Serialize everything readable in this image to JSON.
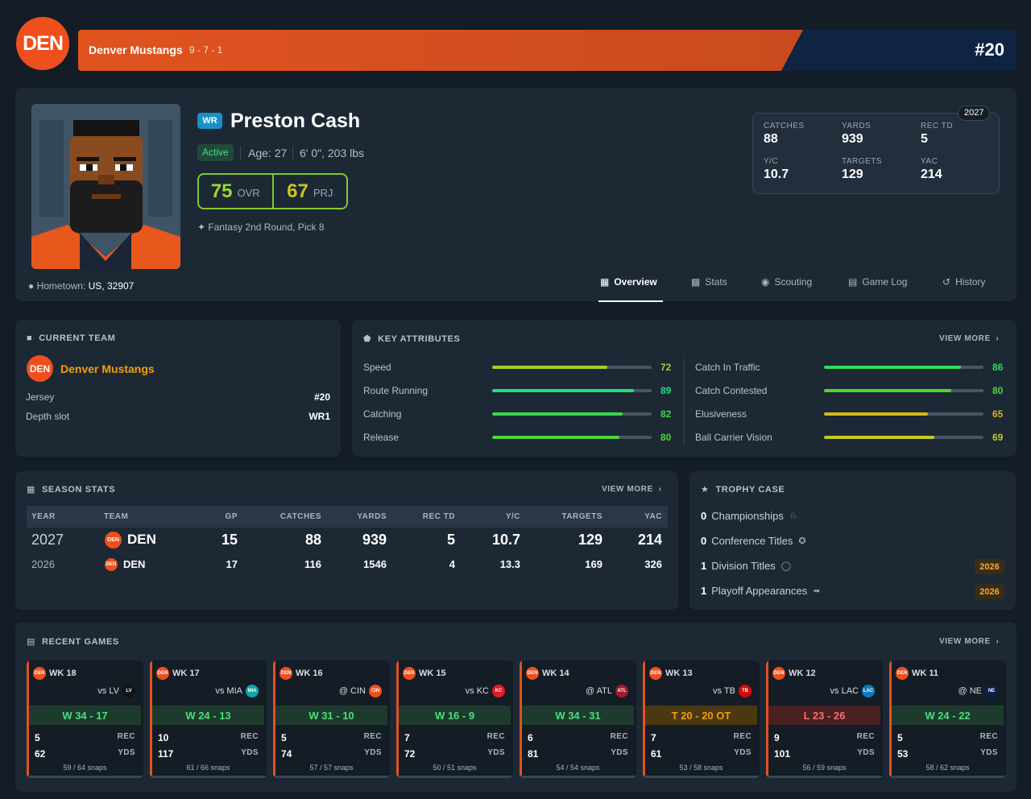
{
  "header": {
    "logo": "DEN",
    "team_name": "Denver Mustangs",
    "record": "9 - 7 - 1",
    "jersey": "#20"
  },
  "player": {
    "position": "WR",
    "name": "Preston Cash",
    "status": "Active",
    "age": "Age: 27",
    "size": "6' 0\", 203 lbs",
    "ovr": "75",
    "ovr_label": "OVR",
    "prj": "67",
    "prj_label": "PRJ",
    "draft": "Fantasy 2nd Round, Pick 8",
    "hometown_label": "Hometown:",
    "hometown": "US, 32907"
  },
  "stat_box": {
    "year": "2027",
    "items": [
      {
        "label": "CATCHES",
        "value": "88"
      },
      {
        "label": "YARDS",
        "value": "939"
      },
      {
        "label": "REC TD",
        "value": "5"
      },
      {
        "label": "Y/C",
        "value": "10.7"
      },
      {
        "label": "TARGETS",
        "value": "129"
      },
      {
        "label": "YAC",
        "value": "214"
      }
    ]
  },
  "tabs": [
    {
      "label": "Overview",
      "icon": "grid-icon"
    },
    {
      "label": "Stats",
      "icon": "bar-chart-icon"
    },
    {
      "label": "Scouting",
      "icon": "eye-icon"
    },
    {
      "label": "Game Log",
      "icon": "calendar-icon"
    },
    {
      "label": "History",
      "icon": "history-icon"
    }
  ],
  "current_team": {
    "title": "CURRENT TEAM",
    "logo": "DEN",
    "name": "Denver Mustangs",
    "jersey_label": "Jersey",
    "jersey": "#20",
    "depth_label": "Depth slot",
    "depth": "WR1"
  },
  "attributes": {
    "title": "KEY ATTRIBUTES",
    "view_more": "VIEW MORE",
    "left": [
      {
        "label": "Speed",
        "value": "72",
        "pct": 72,
        "color": "#a3d12a"
      },
      {
        "label": "Route Running",
        "value": "89",
        "pct": 89,
        "color": "#22e07a"
      },
      {
        "label": "Catching",
        "value": "82",
        "pct": 82,
        "color": "#39d84e"
      },
      {
        "label": "Release",
        "value": "80",
        "pct": 80,
        "color": "#4dd63a"
      }
    ],
    "right": [
      {
        "label": "Catch In Traffic",
        "value": "86",
        "pct": 86,
        "color": "#2fdc5a"
      },
      {
        "label": "Catch Contested",
        "value": "80",
        "pct": 80,
        "color": "#4dd63a"
      },
      {
        "label": "Elusiveness",
        "value": "65",
        "pct": 65,
        "color": "#d4b61c"
      },
      {
        "label": "Ball Carrier Vision",
        "value": "69",
        "pct": 69,
        "color": "#c0cc22"
      }
    ]
  },
  "season": {
    "title": "SEASON STATS",
    "view_more": "VIEW MORE",
    "headers": [
      "YEAR",
      "TEAM",
      "GP",
      "CATCHES",
      "YARDS",
      "REC TD",
      "Y/C",
      "TARGETS",
      "YAC"
    ],
    "rows": [
      {
        "year": "2027",
        "logo": "DEN",
        "team": "DEN",
        "gp": "15",
        "catches": "88",
        "yards": "939",
        "td": "5",
        "yc": "10.7",
        "targets": "129",
        "yac": "214"
      },
      {
        "year": "2026",
        "logo": "DEN",
        "team": "DEN",
        "gp": "17",
        "catches": "116",
        "yards": "1546",
        "td": "4",
        "yc": "13.3",
        "targets": "169",
        "yac": "326"
      }
    ]
  },
  "trophy": {
    "title": "TROPHY CASE",
    "items": [
      {
        "count": "0",
        "label": "Championships",
        "year": ""
      },
      {
        "count": "0",
        "label": "Conference Titles",
        "year": ""
      },
      {
        "count": "1",
        "label": "Division Titles",
        "year": "2026"
      },
      {
        "count": "1",
        "label": "Playoff Appearances",
        "year": "2026"
      }
    ]
  },
  "recent": {
    "title": "RECENT GAMES",
    "view_more": "VIEW MORE",
    "rec_label": "REC",
    "yds_label": "YDS",
    "games": [
      {
        "week": "WK 18",
        "opp": "vs LV",
        "opp_logo": "LV",
        "opp_color": "#111111",
        "result": "W 34 - 17",
        "type": "W",
        "rec": "5",
        "yds": "62",
        "snaps": "59 / 64 snaps"
      },
      {
        "week": "WK 17",
        "opp": "vs MIA",
        "opp_logo": "MIA",
        "opp_color": "#0ea5a5",
        "result": "W 24 - 13",
        "type": "W",
        "rec": "10",
        "yds": "117",
        "snaps": "61 / 66 snaps"
      },
      {
        "week": "WK 16",
        "opp": "@ CIN",
        "opp_logo": "CIN",
        "opp_color": "#ee4f1c",
        "result": "W 31 - 10",
        "type": "W",
        "rec": "5",
        "yds": "74",
        "snaps": "57 / 57 snaps"
      },
      {
        "week": "WK 15",
        "opp": "vs KC",
        "opp_logo": "KC",
        "opp_color": "#e31b23",
        "result": "W 16 - 9",
        "type": "W",
        "rec": "7",
        "yds": "72",
        "snaps": "50 / 51 snaps"
      },
      {
        "week": "WK 14",
        "opp": "@ ATL",
        "opp_logo": "ATL",
        "opp_color": "#a3192d",
        "result": "W 34 - 31",
        "type": "W",
        "rec": "6",
        "yds": "81",
        "snaps": "54 / 54 snaps"
      },
      {
        "week": "WK 13",
        "opp": "vs TB",
        "opp_logo": "TB",
        "opp_color": "#d50a0a",
        "result": "T 20 - 20 OT",
        "type": "T",
        "rec": "7",
        "yds": "61",
        "snaps": "53 / 58 snaps"
      },
      {
        "week": "WK 12",
        "opp": "vs LAC",
        "opp_logo": "LAC",
        "opp_color": "#0a7ac2",
        "result": "L 23 - 26",
        "type": "L",
        "rec": "9",
        "yds": "101",
        "snaps": "56 / 59 snaps"
      },
      {
        "week": "WK 11",
        "opp": "@ NE",
        "opp_logo": "NE",
        "opp_color": "#0b1f4d",
        "result": "W 24 - 22",
        "type": "W",
        "rec": "5",
        "yds": "53",
        "snaps": "58 / 62 snaps"
      }
    ]
  }
}
